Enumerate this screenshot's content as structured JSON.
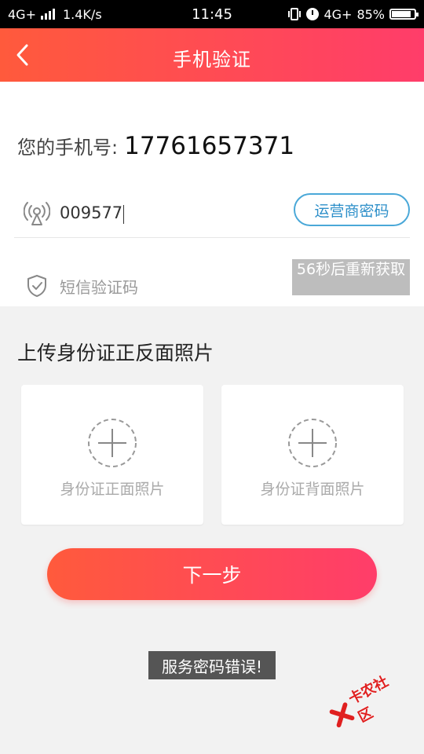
{
  "status_bar": {
    "network": "4G+",
    "speed": "1.4K/s",
    "time": "11:45",
    "network_right": "4G+",
    "battery": "85%"
  },
  "header": {
    "title": "手机验证"
  },
  "form": {
    "phone_label": "您的手机号:",
    "phone_number": "17761657371",
    "service_password_value": "009577",
    "service_password_button": "运营商密码",
    "sms_placeholder": "短信验证码",
    "countdown_button": "56秒后重新获取"
  },
  "upload": {
    "title": "上传身份证正反面照片",
    "front_label": "身份证正面照片",
    "back_label": "身份证背面照片"
  },
  "next_button": "下一步",
  "toast": "服务密码错误!",
  "watermark": "卡农社区",
  "colors": {
    "accent_start": "#ff5a3c",
    "accent_end": "#ff3d6a",
    "outline_button": "#4aa8d8",
    "countdown_bg": "#bdbdbd"
  },
  "battery_level": 0.85
}
